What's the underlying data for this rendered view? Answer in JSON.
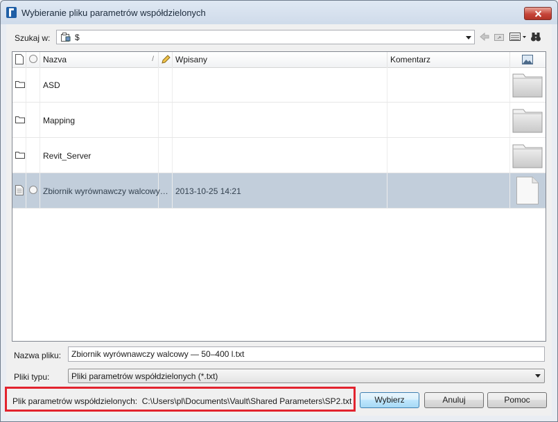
{
  "window": {
    "title": "Wybieranie pliku parametrów współdzielonych"
  },
  "toolbar": {
    "look_in_label": "Szukaj w:",
    "look_in_value": "$",
    "icons": [
      "back-arrow-icon",
      "up-folder-icon",
      "views-menu-icon",
      "binoculars-icon"
    ]
  },
  "filelist": {
    "columns": {
      "name": "Nazva",
      "checked_in": "Wpisany",
      "comment": "Komentarz"
    },
    "rows": [
      {
        "type": "folder",
        "name": "ASD",
        "date": "",
        "comment": ""
      },
      {
        "type": "folder",
        "name": "Mapping",
        "date": "",
        "comment": ""
      },
      {
        "type": "folder",
        "name": "Revit_Server",
        "date": "",
        "comment": ""
      },
      {
        "type": "file",
        "name": "Zbiornik wyrównawczy walcowy…",
        "date": "2013-10-25 14:21",
        "comment": "",
        "selected": true
      }
    ]
  },
  "form": {
    "filename_label": "Nazwa pliku:",
    "filename_value": "Zbiornik wyrównawczy walcowy — 50–400 l.txt",
    "filetype_label": "Pliki typu:",
    "filetype_value": "Pliki parametrów współdzielonych (*.txt)"
  },
  "shared_file": {
    "label": "Plik parametrów współdzielonych:",
    "path": "C:\\Users\\pl\\Documents\\Vault\\Shared Parameters\\SP2.txt"
  },
  "buttons": {
    "ok": "Wybierz",
    "cancel": "Anuluj",
    "help": "Pomoc"
  },
  "colors": {
    "selection": "#c2cedb",
    "highlight_box": "#e2232e"
  }
}
